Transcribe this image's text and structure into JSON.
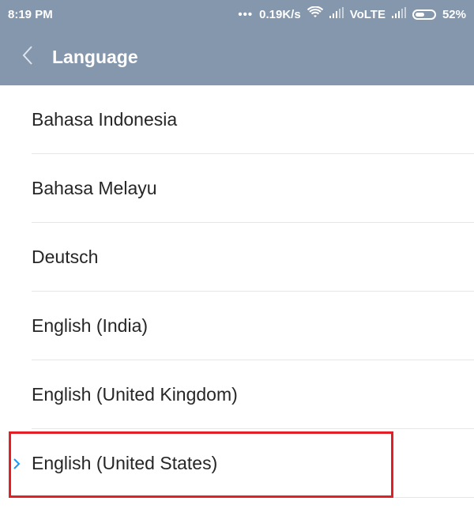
{
  "status_bar": {
    "time": "8:19 PM",
    "dots": "•••",
    "net_speed": "0.19K/s",
    "volte": "VoLTE",
    "battery_percent": "52%",
    "battery_level": 0.52,
    "icons": [
      "wifi-icon",
      "signal-icon",
      "signal-icon",
      "battery-icon"
    ]
  },
  "app_bar": {
    "back_icon": "chevron-left-icon",
    "title": "Language",
    "background": "#8597ad"
  },
  "languages": {
    "items": [
      {
        "label": "Bahasa Indonesia"
      },
      {
        "label": "Bahasa Melayu"
      },
      {
        "label": "Deutsch"
      },
      {
        "label": "English (India)"
      },
      {
        "label": "English (United Kingdom)"
      },
      {
        "label": "English (United States)",
        "selected": true
      }
    ],
    "selected_marker_icon": "chevron-right-icon",
    "selected_marker_color": "#2196f3"
  },
  "annotation": {
    "highlight_color": "#e31e24"
  }
}
